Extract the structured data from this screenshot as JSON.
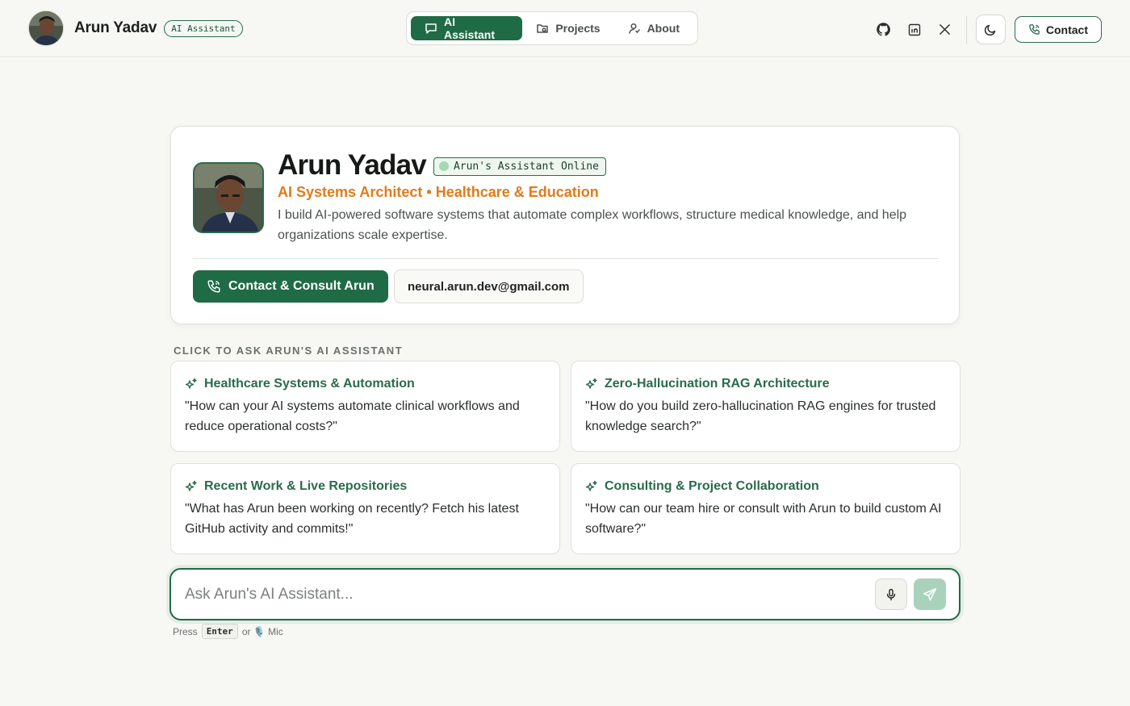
{
  "header": {
    "brand_name": "Arun Yadav",
    "brand_badge": "AI Assistant",
    "nav": [
      {
        "label": "AI Assistant",
        "icon": "chat-icon",
        "active": true
      },
      {
        "label": "Projects",
        "icon": "folder-icon",
        "active": false
      },
      {
        "label": "About",
        "icon": "user-icon",
        "active": false
      }
    ],
    "social": [
      "github-icon",
      "linkedin-icon",
      "x-icon"
    ],
    "theme_icon": "moon-icon",
    "contact_label": "Contact"
  },
  "profile": {
    "name": "Arun Yadav",
    "status": "Arun's Assistant Online",
    "title": "AI Systems Architect • Healthcare & Education",
    "bio": "I build AI-powered software systems that automate complex workflows, structure medical knowledge, and help organizations scale expertise.",
    "primary_button": "Contact & Consult Arun",
    "email": "neural.arun.dev@gmail.com"
  },
  "suggestions": {
    "label": "CLICK TO ASK ARUN'S AI ASSISTANT",
    "items": [
      {
        "title": "Healthcare Systems & Automation",
        "question": "\"How can your AI systems automate clinical workflows and reduce operational costs?\""
      },
      {
        "title": "Zero-Hallucination RAG Architecture",
        "question": "\"How do you build zero-hallucination RAG engines for trusted knowledge search?\""
      },
      {
        "title": "Recent Work & Live Repositories",
        "question": "\"What has Arun been working on recently? Fetch his latest GitHub activity and commits!\""
      },
      {
        "title": "Consulting & Project Collaboration",
        "question": "\"How can our team hire or consult with Arun to build custom AI software?\""
      }
    ]
  },
  "chat": {
    "placeholder": "Ask Arun's AI Assistant...",
    "hint_press": "Press",
    "hint_key": "Enter",
    "hint_or": "or 🎙️ Mic"
  },
  "colors": {
    "accent": "#1f6b45",
    "title_orange": "#e07b1a",
    "background": "#f7f7f3"
  }
}
